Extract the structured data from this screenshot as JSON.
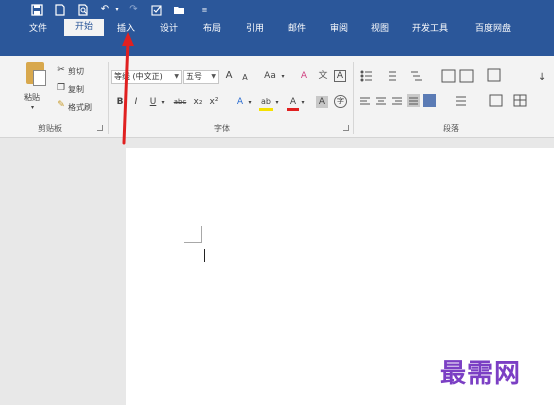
{
  "quick_access": {
    "icons": [
      "save-icon",
      "new-document-icon",
      "print-preview-icon",
      "undo-icon",
      "redo-icon",
      "checklist-icon",
      "open-folder-icon",
      "customize-icon"
    ],
    "undo_glyph": "↶",
    "redo_glyph": "↷"
  },
  "tabs": [
    "文件",
    "开始",
    "插入",
    "设计",
    "布局",
    "引用",
    "邮件",
    "审阅",
    "视图",
    "开发工具",
    "百度网盘"
  ],
  "active_tab": "开始",
  "clipboard": {
    "paste": "粘贴",
    "cut": "剪切",
    "copy": "复制",
    "format_painter": "格式刷",
    "group_label": "剪贴板"
  },
  "font": {
    "font_name": "等线 (中文正)",
    "font_size": "五号",
    "grow": "A",
    "shrink": "A",
    "change_case": "Aa",
    "clear_format": "A",
    "phonetic": "文",
    "border_char": "A",
    "bold": "B",
    "italic": "I",
    "underline": "U",
    "strikethrough": "abc",
    "subscript": "x₂",
    "superscript": "x²",
    "text_effects": "A",
    "highlight": "ab",
    "font_color": "A",
    "char_shading": "A",
    "enclose": "字",
    "group_label": "字体"
  },
  "paragraph": {
    "group_label": "段落"
  },
  "watermark": "最需网",
  "colors": {
    "ribbon_blue": "#2b579a",
    "annotation_red": "#e02020",
    "watermark_purple": "#7b3fc4",
    "highlight_yellow": "#f5e100",
    "font_color_red": "#e02020"
  }
}
